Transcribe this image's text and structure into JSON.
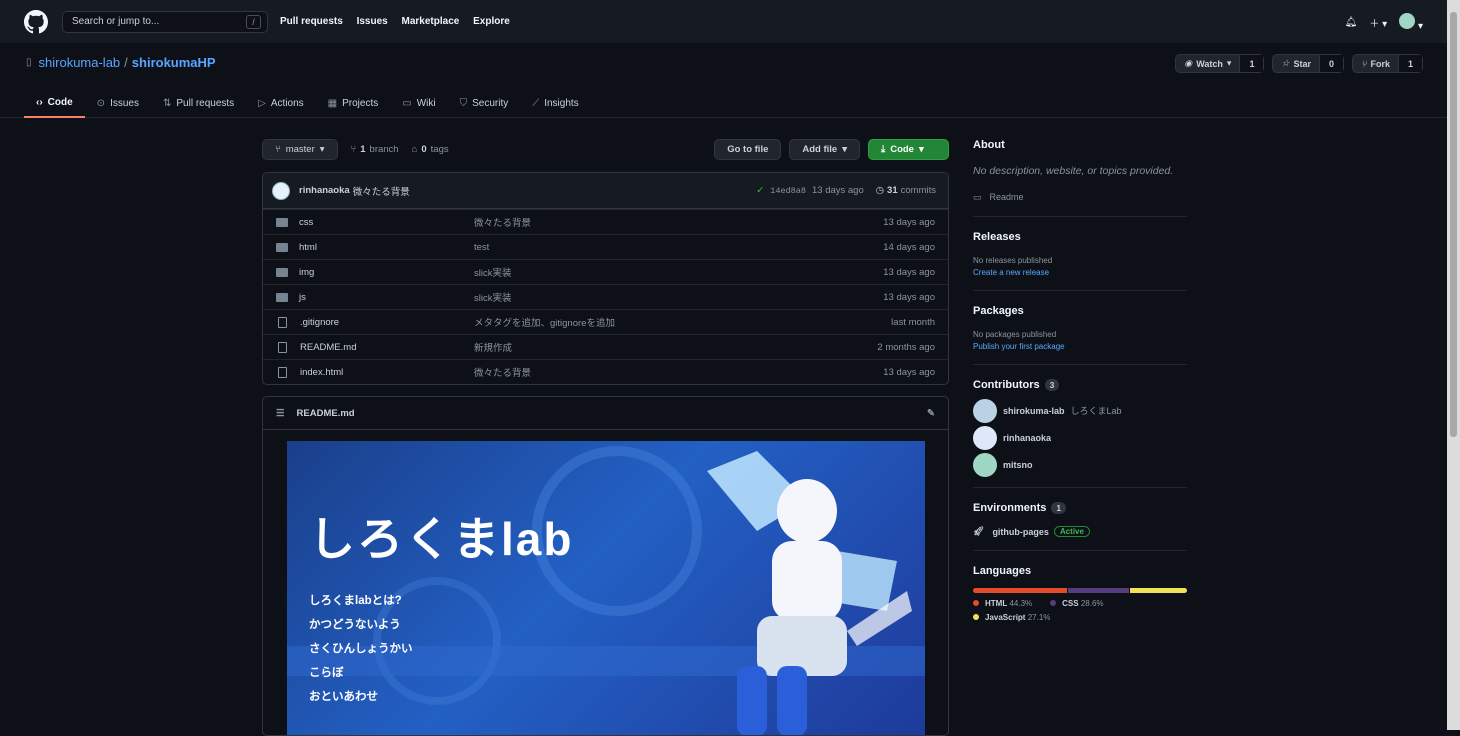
{
  "header": {
    "search_placeholder": "Search or jump to...",
    "search_key": "/",
    "nav": [
      "Pull requests",
      "Issues",
      "Marketplace",
      "Explore"
    ]
  },
  "repo": {
    "owner": "shirokuma-lab",
    "sep": "/",
    "name": "shirokumaHP",
    "watch": {
      "label": "Watch",
      "count": "1"
    },
    "star": {
      "label": "Star",
      "count": "0"
    },
    "fork": {
      "label": "Fork",
      "count": "1"
    }
  },
  "tabs": [
    {
      "label": "Code",
      "icon": "code-icon"
    },
    {
      "label": "Issues",
      "icon": "issue-icon"
    },
    {
      "label": "Pull requests",
      "icon": "pr-icon"
    },
    {
      "label": "Actions",
      "icon": "play-icon"
    },
    {
      "label": "Projects",
      "icon": "project-icon"
    },
    {
      "label": "Wiki",
      "icon": "book-icon"
    },
    {
      "label": "Security",
      "icon": "shield-icon"
    },
    {
      "label": "Insights",
      "icon": "graph-icon"
    }
  ],
  "toolbar": {
    "branch": "master",
    "branches_count": "1",
    "branches_label": "branch",
    "tags_count": "0",
    "tags_label": "tags",
    "go_to_file": "Go to file",
    "add_file": "Add file",
    "code": "Code"
  },
  "commit": {
    "author": "rinhanaoka",
    "message": "微々たる背景",
    "sha": "14ed8a8",
    "age": "13 days ago",
    "commits_count": "31",
    "commits_label": "commits"
  },
  "files": [
    {
      "type": "dir",
      "name": "css",
      "msg": "微々たる背景",
      "age": "13 days ago"
    },
    {
      "type": "dir",
      "name": "html",
      "msg": "test",
      "age": "14 days ago"
    },
    {
      "type": "dir",
      "name": "img",
      "msg": "slick実装",
      "age": "13 days ago"
    },
    {
      "type": "dir",
      "name": "js",
      "msg": "slick実装",
      "age": "13 days ago"
    },
    {
      "type": "file",
      "name": ".gitignore",
      "msg": "メタタグを追加、gitignoreを追加",
      "age": "last month"
    },
    {
      "type": "file",
      "name": "README.md",
      "msg": "新規作成",
      "age": "2 months ago"
    },
    {
      "type": "file",
      "name": "index.html",
      "msg": "微々たる背景",
      "age": "13 days ago"
    }
  ],
  "readme": {
    "title": "README.md",
    "banner_title": "しろくまlab",
    "banner_menu": [
      "しろくまlabとは?",
      "かつどうないよう",
      "さくひんしょうかい",
      "こらぼ",
      "おといあわせ"
    ]
  },
  "about": {
    "title": "About",
    "desc": "No description, website, or topics provided.",
    "readme": "Readme"
  },
  "releases": {
    "title": "Releases",
    "none": "No releases published",
    "link": "Create a new release"
  },
  "packages": {
    "title": "Packages",
    "none": "No packages published",
    "link": "Publish your first package"
  },
  "contributors": {
    "title": "Contributors",
    "count": "3",
    "people": [
      {
        "name": "shirokuma-lab",
        "sub": "しろくまLab"
      },
      {
        "name": "rinhanaoka",
        "sub": ""
      },
      {
        "name": "mitsno",
        "sub": ""
      }
    ]
  },
  "environments": {
    "title": "Environments",
    "count": "1",
    "name": "github-pages",
    "status": "Active"
  },
  "languages": {
    "title": "Languages",
    "items": [
      {
        "name": "HTML",
        "pct": "44.3%",
        "value": 44.3,
        "color": "#e34c26"
      },
      {
        "name": "CSS",
        "pct": "28.6%",
        "value": 28.6,
        "color": "#563d7c"
      },
      {
        "name": "JavaScript",
        "pct": "27.1%",
        "value": 27.1,
        "color": "#f1e05a"
      }
    ]
  }
}
